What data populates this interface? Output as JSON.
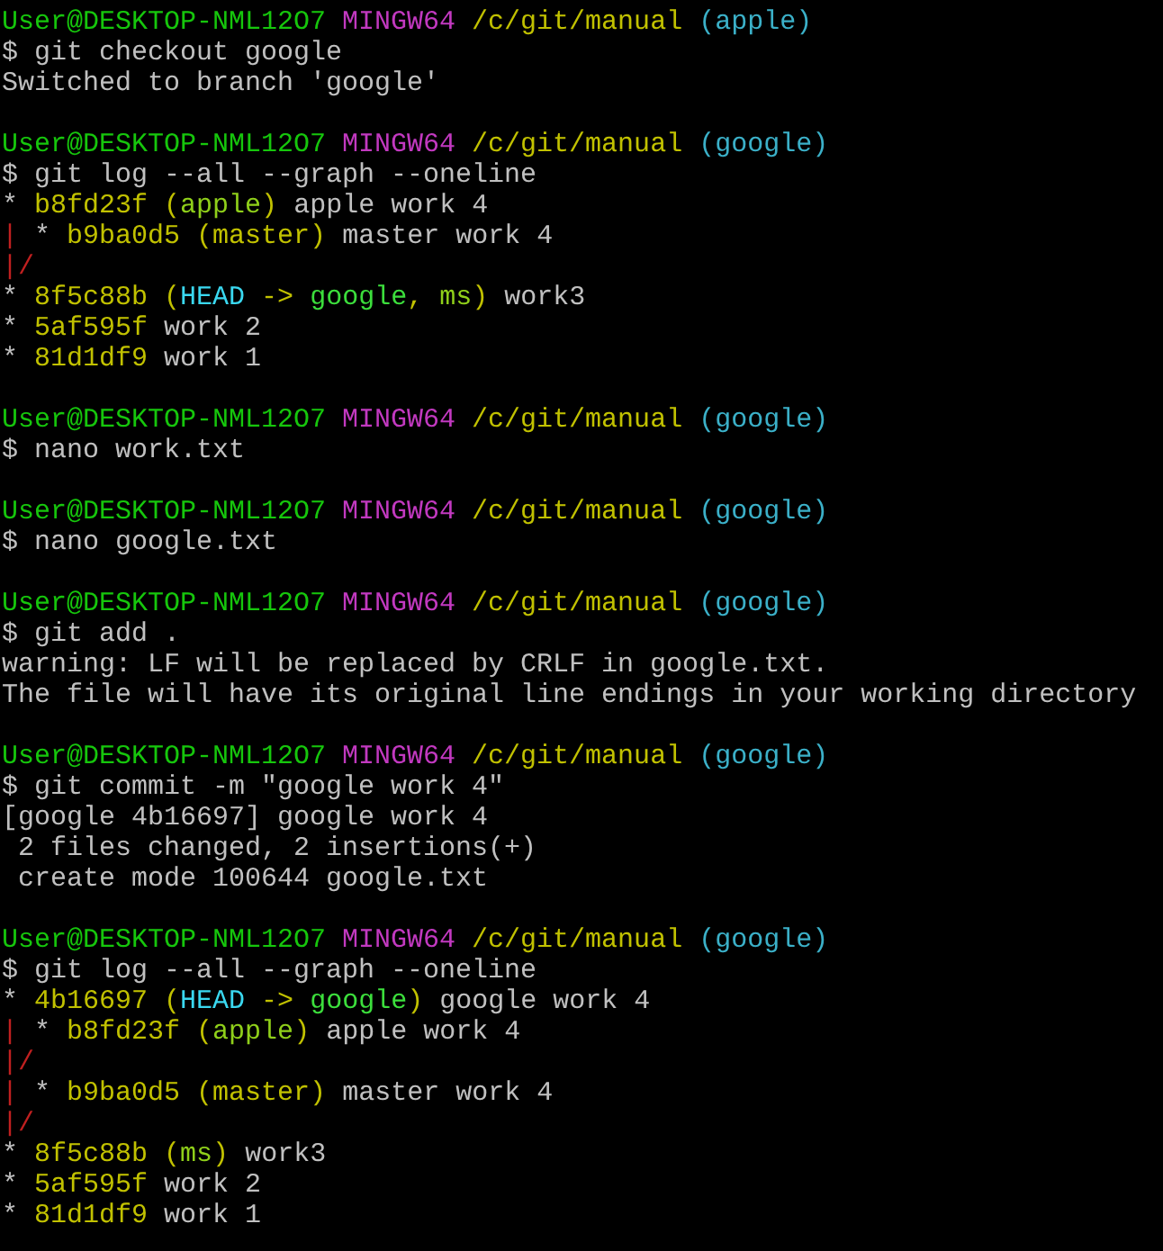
{
  "lines": [
    {
      "kind": "text",
      "spans": [
        {
          "text": "User@DESKTOP-NML12O7 ",
          "color": "#16c60c"
        },
        {
          "text": "MINGW64 ",
          "color": "#c239c0"
        },
        {
          "text": "/c/git/manual ",
          "color": "#c1c100"
        },
        {
          "text": "(apple)",
          "color": "#3bb0c8"
        }
      ]
    },
    {
      "kind": "text",
      "spans": [
        {
          "text": "$ git checkout google",
          "color": "#c0c0c0"
        }
      ]
    },
    {
      "kind": "text",
      "spans": [
        {
          "text": "Switched to branch 'google'",
          "color": "#c0c0c0"
        }
      ]
    },
    {
      "kind": "blank"
    },
    {
      "kind": "text",
      "spans": [
        {
          "text": "User@DESKTOP-NML12O7 ",
          "color": "#16c60c"
        },
        {
          "text": "MINGW64 ",
          "color": "#c239c0"
        },
        {
          "text": "/c/git/manual ",
          "color": "#c1c100"
        },
        {
          "text": "(google)",
          "color": "#3bb0c8"
        }
      ]
    },
    {
      "kind": "text",
      "spans": [
        {
          "text": "$ git log --all --graph --oneline",
          "color": "#c0c0c0"
        }
      ]
    },
    {
      "kind": "text",
      "spans": [
        {
          "text": "* ",
          "color": "#c0c0c0"
        },
        {
          "text": "b8fd23f (",
          "color": "#c1c100"
        },
        {
          "text": "apple",
          "color": "#8fcf1a"
        },
        {
          "text": ")",
          "color": "#c1c100"
        },
        {
          "text": " apple work 4",
          "color": "#c0c0c0"
        }
      ]
    },
    {
      "kind": "text",
      "spans": [
        {
          "text": "| ",
          "color": "#c02020"
        },
        {
          "text": "* ",
          "color": "#c0c0c0"
        },
        {
          "text": "b9ba0d5 (master)",
          "color": "#c1c100"
        },
        {
          "text": " master work 4",
          "color": "#c0c0c0"
        }
      ]
    },
    {
      "kind": "text",
      "spans": [
        {
          "text": "|/",
          "color": "#c02020"
        }
      ]
    },
    {
      "kind": "text",
      "spans": [
        {
          "text": "* ",
          "color": "#c0c0c0"
        },
        {
          "text": "8f5c88b (",
          "color": "#c1c100"
        },
        {
          "text": "HEAD",
          "color": "#3ad8f0"
        },
        {
          "text": " -> ",
          "color": "#c1c100"
        },
        {
          "text": "google",
          "color": "#3cde3c"
        },
        {
          "text": ", ",
          "color": "#c1c100"
        },
        {
          "text": "ms",
          "color": "#8fcf1a"
        },
        {
          "text": ")",
          "color": "#c1c100"
        },
        {
          "text": " work3",
          "color": "#c0c0c0"
        }
      ]
    },
    {
      "kind": "text",
      "spans": [
        {
          "text": "* ",
          "color": "#c0c0c0"
        },
        {
          "text": "5af595f",
          "color": "#c1c100"
        },
        {
          "text": " work 2",
          "color": "#c0c0c0"
        }
      ]
    },
    {
      "kind": "text",
      "spans": [
        {
          "text": "* ",
          "color": "#c0c0c0"
        },
        {
          "text": "81d1df9",
          "color": "#c1c100"
        },
        {
          "text": " work 1",
          "color": "#c0c0c0"
        }
      ]
    },
    {
      "kind": "blank"
    },
    {
      "kind": "text",
      "spans": [
        {
          "text": "User@DESKTOP-NML12O7 ",
          "color": "#16c60c"
        },
        {
          "text": "MINGW64 ",
          "color": "#c239c0"
        },
        {
          "text": "/c/git/manual ",
          "color": "#c1c100"
        },
        {
          "text": "(google)",
          "color": "#3bb0c8"
        }
      ]
    },
    {
      "kind": "text",
      "spans": [
        {
          "text": "$ nano work.txt",
          "color": "#c0c0c0"
        }
      ]
    },
    {
      "kind": "blank"
    },
    {
      "kind": "text",
      "spans": [
        {
          "text": "User@DESKTOP-NML12O7 ",
          "color": "#16c60c"
        },
        {
          "text": "MINGW64 ",
          "color": "#c239c0"
        },
        {
          "text": "/c/git/manual ",
          "color": "#c1c100"
        },
        {
          "text": "(google)",
          "color": "#3bb0c8"
        }
      ]
    },
    {
      "kind": "text",
      "spans": [
        {
          "text": "$ nano google.txt",
          "color": "#c0c0c0"
        }
      ]
    },
    {
      "kind": "blank"
    },
    {
      "kind": "text",
      "spans": [
        {
          "text": "User@DESKTOP-NML12O7 ",
          "color": "#16c60c"
        },
        {
          "text": "MINGW64 ",
          "color": "#c239c0"
        },
        {
          "text": "/c/git/manual ",
          "color": "#c1c100"
        },
        {
          "text": "(google)",
          "color": "#3bb0c8"
        }
      ]
    },
    {
      "kind": "text",
      "spans": [
        {
          "text": "$ git add .",
          "color": "#c0c0c0"
        }
      ]
    },
    {
      "kind": "text",
      "spans": [
        {
          "text": "warning: LF will be replaced by CRLF in google.txt.",
          "color": "#c0c0c0"
        }
      ]
    },
    {
      "kind": "text",
      "spans": [
        {
          "text": "The file will have its original line endings in your working directory",
          "color": "#c0c0c0"
        }
      ]
    },
    {
      "kind": "blank"
    },
    {
      "kind": "text",
      "spans": [
        {
          "text": "User@DESKTOP-NML12O7 ",
          "color": "#16c60c"
        },
        {
          "text": "MINGW64 ",
          "color": "#c239c0"
        },
        {
          "text": "/c/git/manual ",
          "color": "#c1c100"
        },
        {
          "text": "(google)",
          "color": "#3bb0c8"
        }
      ]
    },
    {
      "kind": "text",
      "spans": [
        {
          "text": "$ git commit -m \"google work 4\"",
          "color": "#c0c0c0"
        }
      ]
    },
    {
      "kind": "text",
      "spans": [
        {
          "text": "[google 4b16697] google work 4",
          "color": "#c0c0c0"
        }
      ]
    },
    {
      "kind": "text",
      "spans": [
        {
          "text": " 2 files changed, 2 insertions(+)",
          "color": "#c0c0c0"
        }
      ]
    },
    {
      "kind": "text",
      "spans": [
        {
          "text": " create mode 100644 google.txt",
          "color": "#c0c0c0"
        }
      ]
    },
    {
      "kind": "blank"
    },
    {
      "kind": "text",
      "spans": [
        {
          "text": "User@DESKTOP-NML12O7 ",
          "color": "#16c60c"
        },
        {
          "text": "MINGW64 ",
          "color": "#c239c0"
        },
        {
          "text": "/c/git/manual ",
          "color": "#c1c100"
        },
        {
          "text": "(google)",
          "color": "#3bb0c8"
        }
      ]
    },
    {
      "kind": "text",
      "spans": [
        {
          "text": "$ git log --all --graph --oneline",
          "color": "#c0c0c0"
        }
      ]
    },
    {
      "kind": "text",
      "spans": [
        {
          "text": "* ",
          "color": "#c0c0c0"
        },
        {
          "text": "4b16697 (",
          "color": "#c1c100"
        },
        {
          "text": "HEAD",
          "color": "#3ad8f0"
        },
        {
          "text": " -> ",
          "color": "#c1c100"
        },
        {
          "text": "google",
          "color": "#3cde3c"
        },
        {
          "text": ")",
          "color": "#c1c100"
        },
        {
          "text": " google work 4",
          "color": "#c0c0c0"
        }
      ]
    },
    {
      "kind": "text",
      "spans": [
        {
          "text": "| ",
          "color": "#c02020"
        },
        {
          "text": "* ",
          "color": "#c0c0c0"
        },
        {
          "text": "b8fd23f (",
          "color": "#c1c100"
        },
        {
          "text": "apple",
          "color": "#8fcf1a"
        },
        {
          "text": ")",
          "color": "#c1c100"
        },
        {
          "text": " apple work 4",
          "color": "#c0c0c0"
        }
      ]
    },
    {
      "kind": "text",
      "spans": [
        {
          "text": "|/",
          "color": "#c02020"
        }
      ]
    },
    {
      "kind": "text",
      "spans": [
        {
          "text": "| ",
          "color": "#c02020"
        },
        {
          "text": "* ",
          "color": "#c0c0c0"
        },
        {
          "text": "b9ba0d5 (master)",
          "color": "#c1c100"
        },
        {
          "text": " master work 4",
          "color": "#c0c0c0"
        }
      ]
    },
    {
      "kind": "text",
      "spans": [
        {
          "text": "|/",
          "color": "#c02020"
        }
      ]
    },
    {
      "kind": "text",
      "spans": [
        {
          "text": "* ",
          "color": "#c0c0c0"
        },
        {
          "text": "8f5c88b (",
          "color": "#c1c100"
        },
        {
          "text": "ms",
          "color": "#8fcf1a"
        },
        {
          "text": ")",
          "color": "#c1c100"
        },
        {
          "text": " work3",
          "color": "#c0c0c0"
        }
      ]
    },
    {
      "kind": "text",
      "spans": [
        {
          "text": "* ",
          "color": "#c0c0c0"
        },
        {
          "text": "5af595f",
          "color": "#c1c100"
        },
        {
          "text": " work 2",
          "color": "#c0c0c0"
        }
      ]
    },
    {
      "kind": "text",
      "spans": [
        {
          "text": "* ",
          "color": "#c0c0c0"
        },
        {
          "text": "81d1df9",
          "color": "#c1c100"
        },
        {
          "text": " work 1",
          "color": "#c0c0c0"
        }
      ]
    }
  ]
}
